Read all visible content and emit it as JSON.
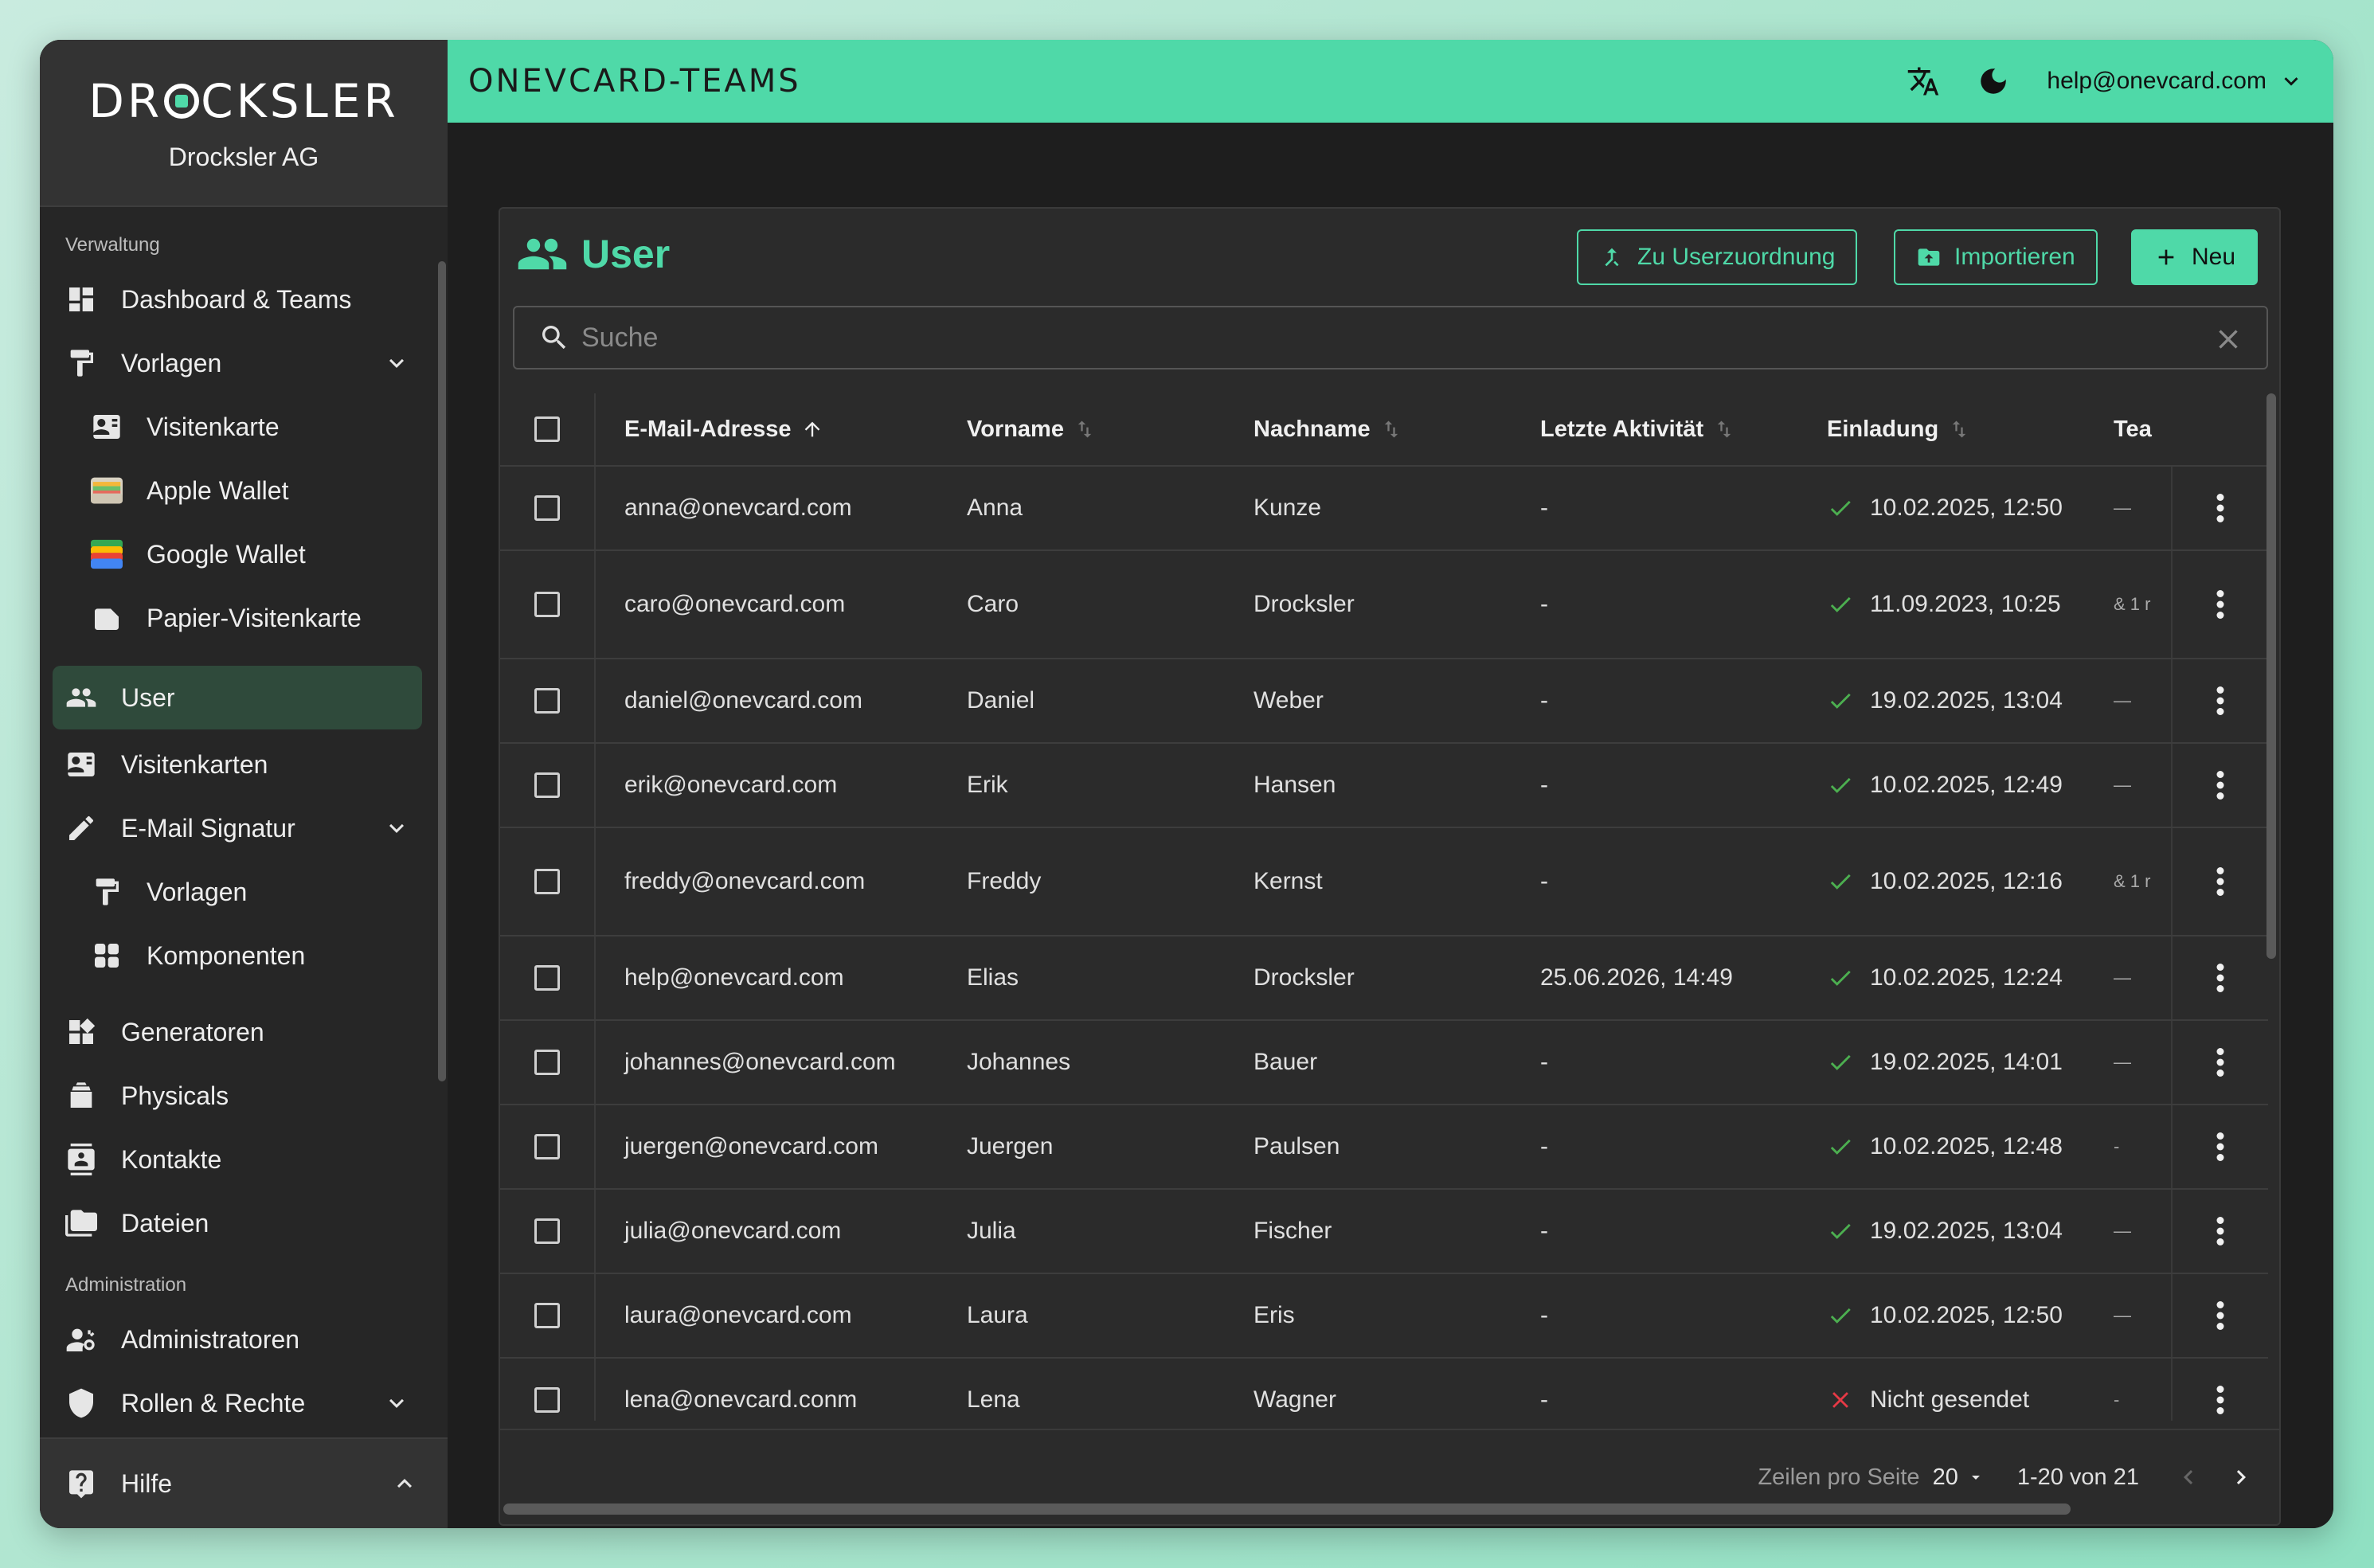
{
  "brand": {
    "logo_text_left": "DR",
    "logo_text_right": "CKSLER",
    "company": "Drocksler AG"
  },
  "header": {
    "product": "ONEVCARD-TEAMS",
    "user_email": "help@onevcard.com"
  },
  "sidebar": {
    "section_verwaltung": "Verwaltung",
    "section_admin": "Administration",
    "items": {
      "dashboard": "Dashboard & Teams",
      "vorlagen": "Vorlagen",
      "visitenkarte": "Visitenkarte",
      "apple_wallet": "Apple Wallet",
      "google_wallet": "Google Wallet",
      "papier": "Papier-Visitenkarte",
      "user": "User",
      "visitenkarten": "Visitenkarten",
      "email_signatur": "E-Mail Signatur",
      "sig_vorlagen": "Vorlagen",
      "komponenten": "Komponenten",
      "generatoren": "Generatoren",
      "physicals": "Physicals",
      "kontakte": "Kontakte",
      "dateien": "Dateien",
      "administratoren": "Administratoren",
      "rollen": "Rollen & Rechte"
    },
    "help": "Hilfe"
  },
  "page": {
    "title": "User",
    "btn_userzuordnung": "Zu Userzuordnung",
    "btn_import": "Importieren",
    "btn_new": "Neu",
    "search_placeholder": "Suche"
  },
  "table": {
    "columns": {
      "email": "E-Mail-Adresse",
      "first": "Vorname",
      "last": "Nachname",
      "activity": "Letzte Aktivität",
      "invite": "Einladung",
      "teams": "Tea"
    },
    "rows": [
      {
        "email": "anna@onevcard.com",
        "first": "Anna",
        "last": "Kunze",
        "activity": "-",
        "invite": "10.02.2025, 12:50",
        "status": "sent",
        "teams": "—"
      },
      {
        "email": "caro@onevcard.com",
        "first": "Caro",
        "last": "Drocksler",
        "activity": "-",
        "invite": "11.09.2023, 10:25",
        "status": "sent",
        "teams": "& 1 r"
      },
      {
        "email": "daniel@onevcard.com",
        "first": "Daniel",
        "last": "Weber",
        "activity": "-",
        "invite": "19.02.2025, 13:04",
        "status": "sent",
        "teams": "—"
      },
      {
        "email": "erik@onevcard.com",
        "first": "Erik",
        "last": "Hansen",
        "activity": "-",
        "invite": "10.02.2025, 12:49",
        "status": "sent",
        "teams": "—"
      },
      {
        "email": "freddy@onevcard.com",
        "first": "Freddy",
        "last": "Kernst",
        "activity": "-",
        "invite": "10.02.2025, 12:16",
        "status": "sent",
        "teams": "& 1 r"
      },
      {
        "email": "help@onevcard.com",
        "first": "Elias",
        "last": "Drocksler",
        "activity": "25.06.2026, 14:49",
        "invite": "10.02.2025, 12:24",
        "status": "sent",
        "teams": "—"
      },
      {
        "email": "johannes@onevcard.com",
        "first": "Johannes",
        "last": "Bauer",
        "activity": "-",
        "invite": "19.02.2025, 14:01",
        "status": "sent",
        "teams": "—"
      },
      {
        "email": "juergen@onevcard.com",
        "first": "Juergen",
        "last": "Paulsen",
        "activity": "-",
        "invite": "10.02.2025, 12:48",
        "status": "sent",
        "teams": "-"
      },
      {
        "email": "julia@onevcard.com",
        "first": "Julia",
        "last": "Fischer",
        "activity": "-",
        "invite": "19.02.2025, 13:04",
        "status": "sent",
        "teams": "—"
      },
      {
        "email": "laura@onevcard.com",
        "first": "Laura",
        "last": "Eris",
        "activity": "-",
        "invite": "10.02.2025, 12:50",
        "status": "sent",
        "teams": "—"
      },
      {
        "email": "lena@onevcard.conm",
        "first": "Lena",
        "last": "Wagner",
        "activity": "-",
        "invite": "Nicht gesendet",
        "status": "not_sent",
        "teams": "-"
      }
    ]
  },
  "footer": {
    "rows_label": "Zeilen pro Seite",
    "rows_value": "20",
    "range": "1-20 von 21"
  },
  "colors": {
    "accent": "#4fd9a8",
    "success": "#4caf50",
    "error": "#e53945"
  }
}
